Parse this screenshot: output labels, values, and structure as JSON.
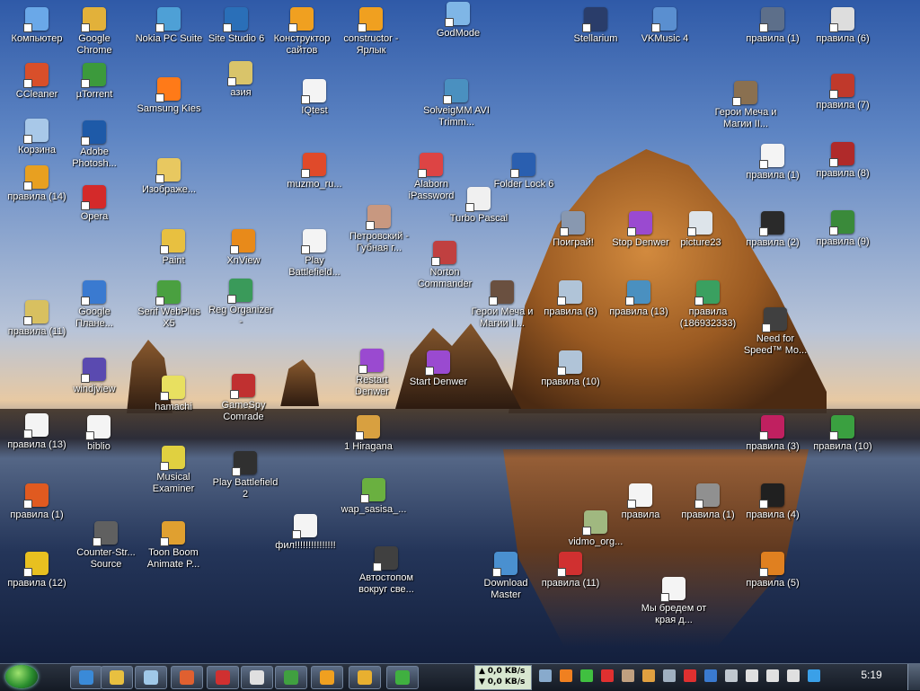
{
  "desktop": {
    "icons": [
      {
        "label": "Компьютер",
        "color": "#6aa8e8"
      },
      {
        "label": "Google Chrome",
        "color": "#e2b13a"
      },
      {
        "label": "Nokia PC Suite",
        "color": "#4ea0d6"
      },
      {
        "label": "Site Studio 6",
        "color": "#2a6fb8"
      },
      {
        "label": "Конструктор сайтов",
        "color": "#f0a020"
      },
      {
        "label": "constructor - Ярлык",
        "color": "#f0a020"
      },
      {
        "label": "GodMode",
        "color": "#7fb6e6"
      },
      {
        "label": "Stellarium",
        "color": "#2a3d6a"
      },
      {
        "label": "VKMusic 4",
        "color": "#5a8fd0"
      },
      {
        "label": "правила (1)",
        "color": "#5d6f8a"
      },
      {
        "label": "правила (6)",
        "color": "#ddd"
      },
      {
        "label": "CCleaner",
        "color": "#d94f2a"
      },
      {
        "label": "µTorrent",
        "color": "#3c9a3c"
      },
      {
        "label": "Samsung Kies",
        "color": "#ff7a18"
      },
      {
        "label": "азия",
        "color": "#d9c46a"
      },
      {
        "label": "IQtest",
        "color": "#f4f4f4"
      },
      {
        "label": "SolveigMM AVI Trimm...",
        "color": "#4a90c0"
      },
      {
        "label": "Герои Меча и Магии II...",
        "color": "#8a7050"
      },
      {
        "label": "правила (7)",
        "color": "#c0392b"
      },
      {
        "label": "Корзина",
        "color": "#a8c8e8"
      },
      {
        "label": "Adobe Photosh...",
        "color": "#1e5aa8"
      },
      {
        "label": "Изображе...",
        "color": "#e8c860"
      },
      {
        "label": "muzmo_ru...",
        "color": "#e04a2a"
      },
      {
        "label": "Alaborn iPassword",
        "color": "#d44"
      },
      {
        "label": "Folder Lock 6",
        "color": "#2a5fb0"
      },
      {
        "label": "правила (1)",
        "color": "#f4f4f4"
      },
      {
        "label": "правила (8)",
        "color": "#b02a2a"
      },
      {
        "label": "правила (14)",
        "color": "#e8a020"
      },
      {
        "label": "Opera",
        "color": "#d42a2a"
      },
      {
        "label": "Turbo Pascal",
        "color": "#f0f0f0"
      },
      {
        "label": "Петровский - Губная г...",
        "color": "#c89880"
      },
      {
        "label": "Поиграй!",
        "color": "#8898b0"
      },
      {
        "label": "Stop Denwer",
        "color": "#9a4ad0"
      },
      {
        "label": "picture23",
        "color": "#dde4ea"
      },
      {
        "label": "правила (2)",
        "color": "#2a2a2a"
      },
      {
        "label": "правила (9)",
        "color": "#3a8a3a"
      },
      {
        "label": "Paint",
        "color": "#e8c040"
      },
      {
        "label": "XnView",
        "color": "#e88a1a"
      },
      {
        "label": "Play Battlefield...",
        "color": "#f4f4f4"
      },
      {
        "label": "Norton Commander",
        "color": "#c04040"
      },
      {
        "label": "Google Плане...",
        "color": "#3a7ad0"
      },
      {
        "label": "Serif WebPlus X5",
        "color": "#4aa040"
      },
      {
        "label": "Reg Organizer -",
        "color": "#3a9a5a"
      },
      {
        "label": "Герои Меча и Магии II...",
        "color": "#6a5040"
      },
      {
        "label": "правила (8)",
        "color": "#b0c4d8"
      },
      {
        "label": "правила (13)",
        "color": "#4a90c0"
      },
      {
        "label": "правила (186932333)",
        "color": "#3aa060"
      },
      {
        "label": "правила (11)",
        "color": "#d8c060"
      },
      {
        "label": "Need for Speed™ Mo...",
        "color": "#404040"
      },
      {
        "label": "windjview",
        "color": "#5a4ab0"
      },
      {
        "label": "hamachi",
        "color": "#e8e060"
      },
      {
        "label": "GameSpy Comrade",
        "color": "#c03030"
      },
      {
        "label": "Restart Denwer",
        "color": "#9a4ad0"
      },
      {
        "label": "Start Denwer",
        "color": "#9a4ad0"
      },
      {
        "label": "правила (10)",
        "color": "#b0c4d8"
      },
      {
        "label": "правила (13)",
        "color": "#f4f4f4"
      },
      {
        "label": "biblio",
        "color": "#f4f4f4"
      },
      {
        "label": "1 Hiragana",
        "color": "#d8a040"
      },
      {
        "label": "правила (3)",
        "color": "#c02060"
      },
      {
        "label": "правила (10)",
        "color": "#3aa040"
      },
      {
        "label": "Musical Examiner",
        "color": "#e0d040"
      },
      {
        "label": "Play Battlefield 2",
        "color": "#303030"
      },
      {
        "label": "правила (1)",
        "color": "#e05a20"
      },
      {
        "label": "wap_sasisa_...",
        "color": "#6ab040"
      },
      {
        "label": "правила",
        "color": "#f4f4f4"
      },
      {
        "label": "правила (1)",
        "color": "#909090"
      },
      {
        "label": "правила (4)",
        "color": "#202020"
      },
      {
        "label": "фил!!!!!!!!!!!!!!!",
        "color": "#f4f4f4"
      },
      {
        "label": "vidmo_org...",
        "color": "#a0b880"
      },
      {
        "label": "Counter-Str... Source",
        "color": "#606060"
      },
      {
        "label": "Toon Boom Animate P...",
        "color": "#e0a030"
      },
      {
        "label": "правила (12)",
        "color": "#e8c020"
      },
      {
        "label": "Автостопом вокруг све...",
        "color": "#404040"
      },
      {
        "label": "Download Master",
        "color": "#4a90d0"
      },
      {
        "label": "правила (11)",
        "color": "#d03030"
      },
      {
        "label": "правила (5)",
        "color": "#e08020"
      },
      {
        "label": "Мы бредем от края д...",
        "color": "#f4f4f4"
      }
    ]
  },
  "taskbar": {
    "network_up": "0,0 KB/s",
    "network_down": "0,0 KB/s",
    "clock": "5:19",
    "pinned": [
      {
        "name": "ie-icon",
        "color": "#3a8ad8"
      },
      {
        "name": "explorer-icon",
        "color": "#e8c040"
      },
      {
        "name": "window-icon",
        "color": "#a0c8e8"
      },
      {
        "name": "apps-icon",
        "color": "#e06030"
      },
      {
        "name": "flag-icon",
        "color": "#d03030"
      },
      {
        "name": "app-icon",
        "color": "#e0e0e0"
      },
      {
        "name": "audio-icon",
        "color": "#40a040"
      },
      {
        "name": "chat-icon",
        "color": "#f0a020"
      },
      {
        "name": "chrome-icon",
        "color": "#e8b030"
      },
      {
        "name": "game-icon",
        "color": "#40b040"
      }
    ],
    "tray": [
      {
        "name": "tray-network-icon",
        "color": "#88aacc"
      },
      {
        "name": "tray-app-orange-icon",
        "color": "#f08020"
      },
      {
        "name": "tray-green-icon",
        "color": "#40c040"
      },
      {
        "name": "tray-red-icon",
        "color": "#e03030"
      },
      {
        "name": "tray-pic-icon",
        "color": "#c0a080"
      },
      {
        "name": "tray-people-icon",
        "color": "#e0a040"
      },
      {
        "name": "tray-gamepad-icon",
        "color": "#a0b0c0"
      },
      {
        "name": "tray-opera-icon",
        "color": "#e03030"
      },
      {
        "name": "tray-bluetooth-icon",
        "color": "#3a7ad0"
      },
      {
        "name": "tray-drive-icon",
        "color": "#c0c8d0"
      },
      {
        "name": "tray-monitor-icon",
        "color": "#e0e0e0"
      },
      {
        "name": "tray-safely-remove-icon",
        "color": "#e0e0e0"
      },
      {
        "name": "tray-volume-icon",
        "color": "#e0e0e0"
      },
      {
        "name": "tray-update-icon",
        "color": "#3aa0e8"
      }
    ]
  }
}
